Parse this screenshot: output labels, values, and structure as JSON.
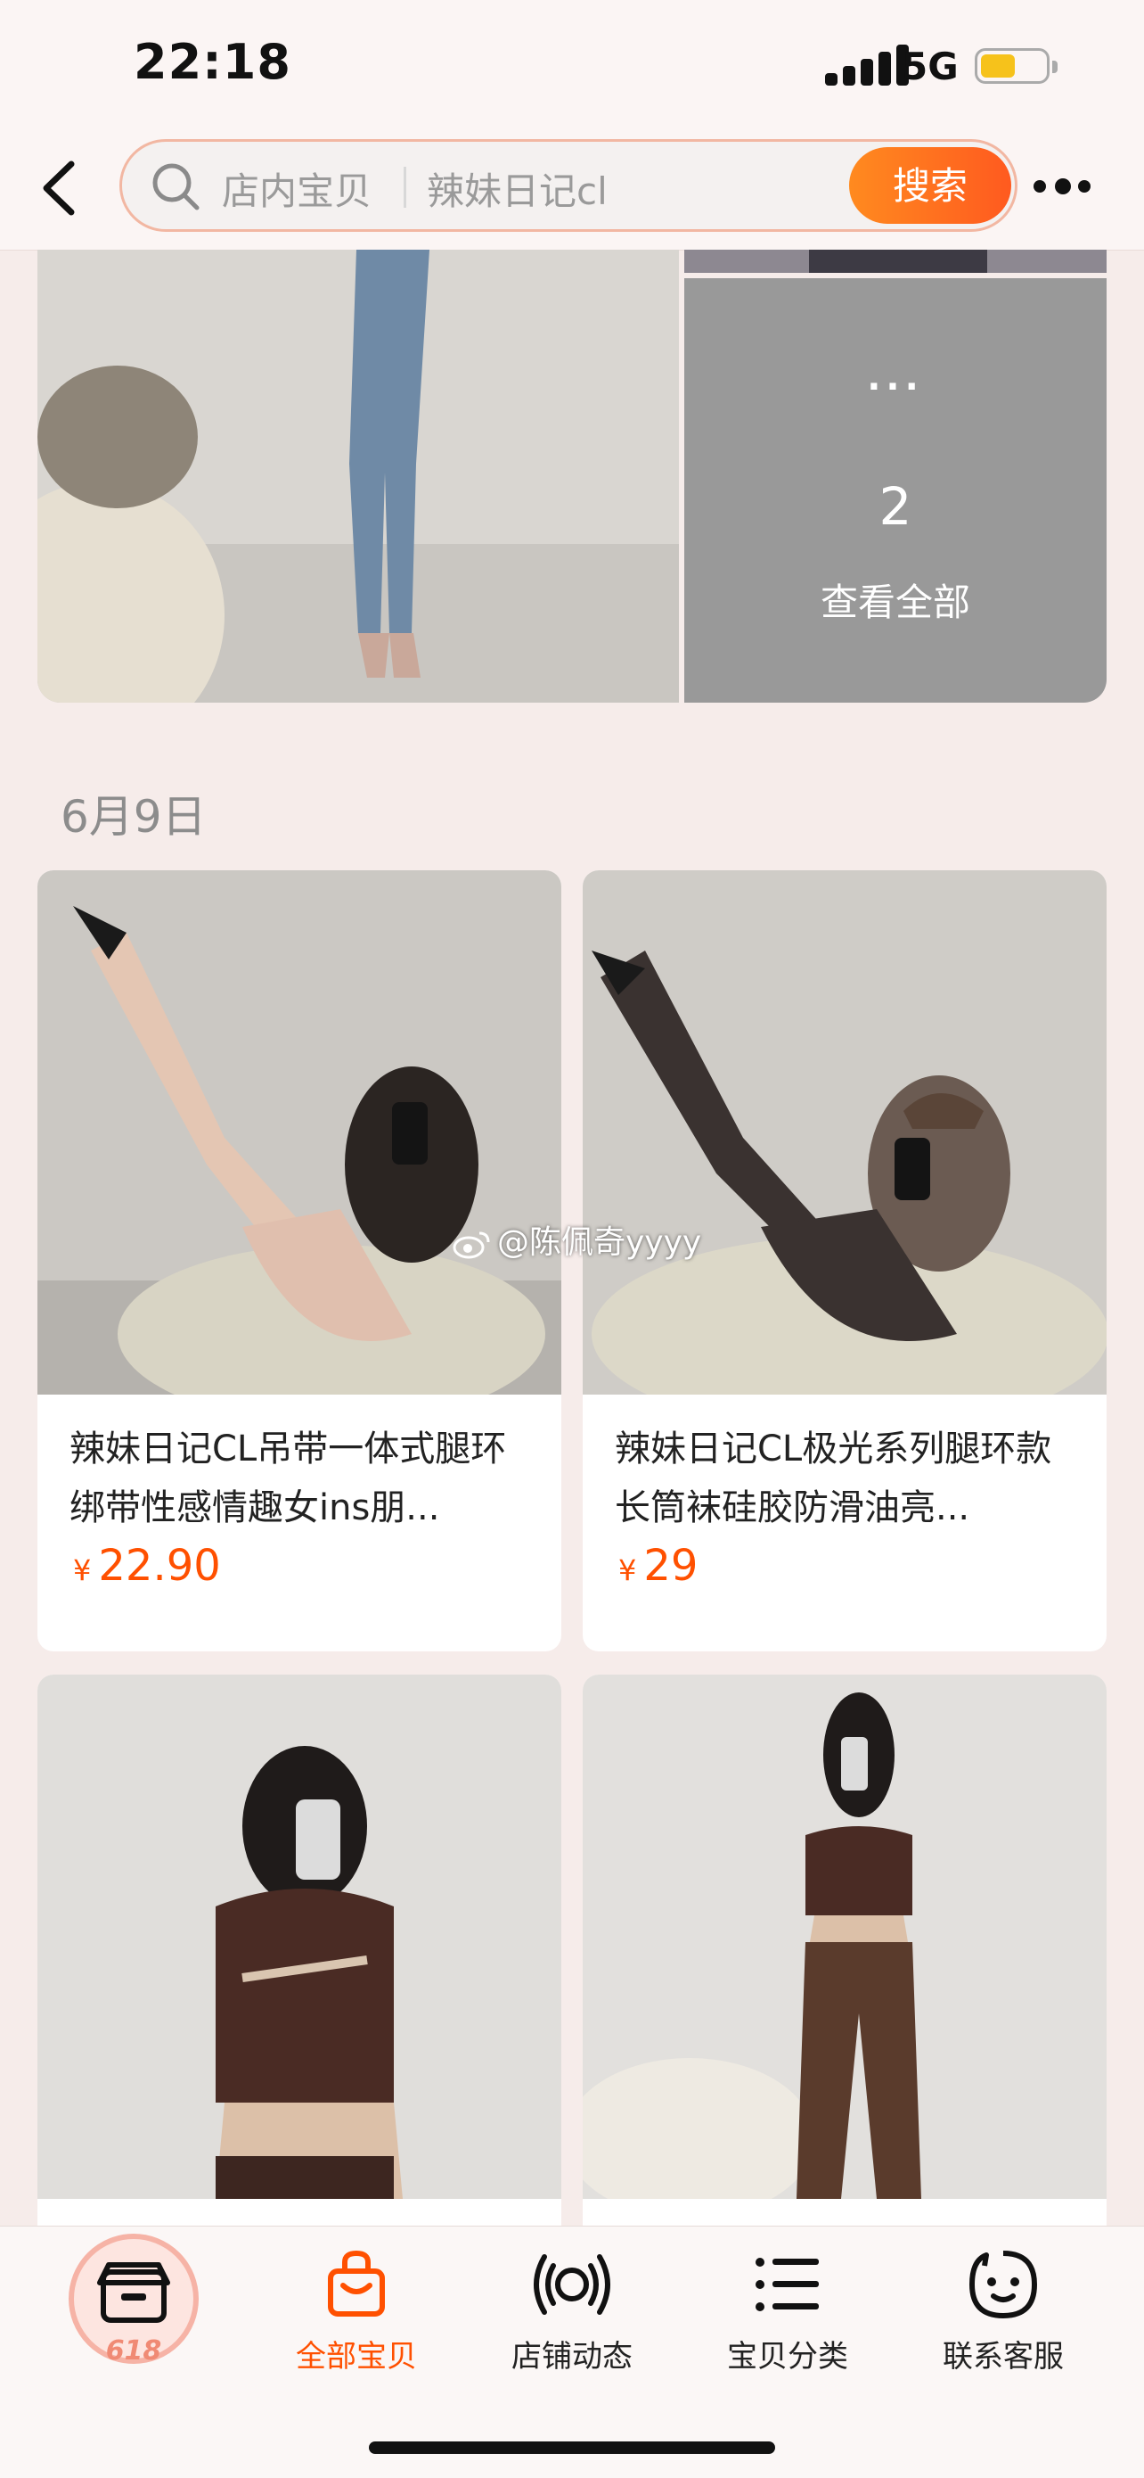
{
  "status_bar": {
    "time": "22:18",
    "network": "5G",
    "icons": [
      "signal-icon",
      "battery-icon"
    ]
  },
  "search": {
    "scope_label": "店内宝贝",
    "query": "辣妹日记cl",
    "button_label": "搜索"
  },
  "gallery": {
    "dots": "···",
    "count": "2",
    "view_all_label": "查看全部"
  },
  "date_header": "6月9日",
  "products": [
    {
      "title": "辣妹日记CL吊带一体式腿环绑带性感情趣女ins朋...",
      "currency": "¥",
      "price": "22.90"
    },
    {
      "title": "辣妹日记CL极光系列腿环款长筒袜硅胶防滑油亮...",
      "currency": "¥",
      "price": "29"
    },
    {
      "title": "",
      "currency": "",
      "price": ""
    },
    {
      "title": "",
      "currency": "",
      "price": ""
    }
  ],
  "watermark": "@陈佩奇yyyy",
  "tabbar": {
    "home_badge": "618",
    "tabs": [
      {
        "label": "全部宝贝",
        "icon": "shopping-bag-icon",
        "active": true
      },
      {
        "label": "店铺动态",
        "icon": "broadcast-icon",
        "active": false
      },
      {
        "label": "宝贝分类",
        "icon": "list-icon",
        "active": false
      },
      {
        "label": "联系客服",
        "icon": "chat-face-icon",
        "active": false
      }
    ]
  },
  "colors": {
    "accent": "#ff5000",
    "search_button": "#ff6a1f",
    "view_all_bg": "#999999"
  }
}
